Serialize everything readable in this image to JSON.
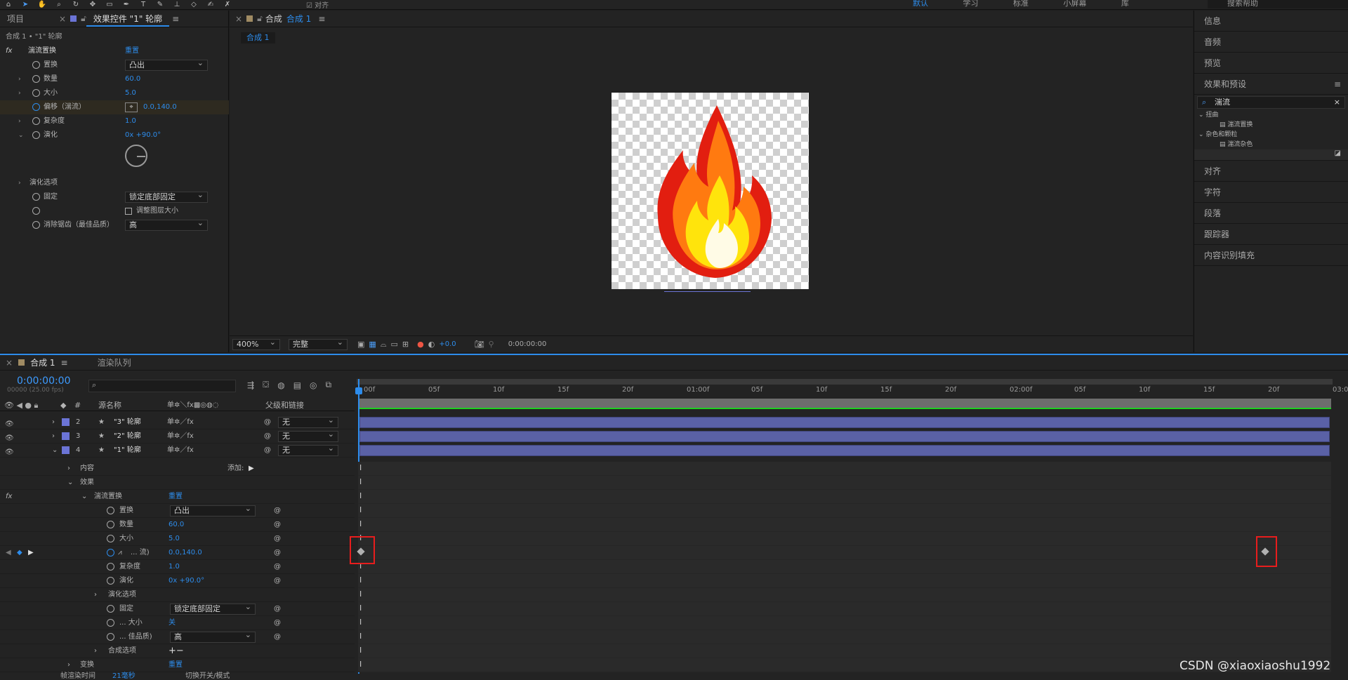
{
  "toolbar": {
    "align_label": "对齐",
    "workspaces": [
      "默认",
      "学习",
      "标准",
      "小屏幕",
      "库"
    ],
    "help_placeholder": "搜索帮助"
  },
  "left_panel": {
    "tabs": [
      "项目",
      "效果控件 \"1\" 轮廓"
    ],
    "breadcrumb": "合成 1 • \"1\" 轮廓",
    "effect": {
      "name": "湍流置换",
      "reset": "重置"
    },
    "props": [
      {
        "name": "置换",
        "value": "凸出"
      },
      {
        "name": "数量",
        "value": "60.0"
      },
      {
        "name": "大小",
        "value": "5.0"
      },
      {
        "name": "偏移（湍流）",
        "value": "0.0,140.0"
      },
      {
        "name": "复杂度",
        "value": "1.0"
      },
      {
        "name": "演化",
        "value": "0x +90.0°"
      }
    ],
    "evo_options": "演化选项",
    "pin": {
      "name": "固定",
      "value": "锁定底部固定"
    },
    "resize_label": "调整图层大小",
    "antialias": {
      "name": "消除锯齿（最佳品质）",
      "value": "高"
    }
  },
  "viewer": {
    "tab_label": "合成",
    "comp_name": "合成 1",
    "zoom": "400%",
    "resolution": "完整",
    "exposure": "+0.0",
    "timecode": "0:00:00:00"
  },
  "right_panel": {
    "items_top": [
      "信息",
      "音频",
      "预览"
    ],
    "effects_title": "效果和预设",
    "search_value": "湍流",
    "tree": [
      {
        "group": "扭曲",
        "item": "湍流置换"
      },
      {
        "group": "杂色和颗粒",
        "item": "湍流杂色"
      }
    ],
    "items_bottom": [
      "对齐",
      "字符",
      "段落",
      "跟踪器",
      "内容识别填充"
    ]
  },
  "timeline": {
    "tabs": [
      "合成 1",
      "渲染队列"
    ],
    "timecode": "0:00:00:00",
    "fps": "00000 (25.00 fps)",
    "col_source": "源名称",
    "col_parent": "父级和链接",
    "layers": [
      {
        "num": "2",
        "name": "\"3\" 轮廓",
        "parent": "无"
      },
      {
        "num": "3",
        "name": "\"2\" 轮廓",
        "parent": "无"
      },
      {
        "num": "4",
        "name": "\"1\" 轮廓",
        "parent": "无"
      }
    ],
    "contents": "内容",
    "add": "添加:",
    "effects": "效果",
    "effect_name": "湍流置换",
    "reset": "重置",
    "props": [
      {
        "name": "置换",
        "value": "凸出"
      },
      {
        "name": "数量",
        "value": "60.0"
      },
      {
        "name": "大小",
        "value": "5.0"
      },
      {
        "name": "... 流)",
        "value": "0.0,140.0"
      },
      {
        "name": "复杂度",
        "value": "1.0"
      },
      {
        "name": "演化",
        "value": "0x +90.0°"
      }
    ],
    "evo_options": "演化选项",
    "pin": {
      "name": "固定",
      "value": "锁定底部固定"
    },
    "size": {
      "name": "... 大小",
      "value": "关"
    },
    "quality": {
      "name": "... 佳品质)",
      "value": "高"
    },
    "comp_options": "合成选项",
    "transform": "变换",
    "ruler": [
      "00f",
      "05f",
      "10f",
      "15f",
      "20f",
      "01:00f",
      "05f",
      "10f",
      "15f",
      "20f",
      "02:00f",
      "05f",
      "10f",
      "15f",
      "20f",
      "03:0"
    ],
    "footer": {
      "render_label": "帧渲染时间",
      "render_value": "21毫秒",
      "toggle": "切换开关/模式"
    }
  },
  "watermark": "CSDN @xiaoxiaoshu1992",
  "colors": {
    "accent": "#2d8ceb",
    "layer_bar": "#5a61a6",
    "highlight": "#e81d1d"
  }
}
